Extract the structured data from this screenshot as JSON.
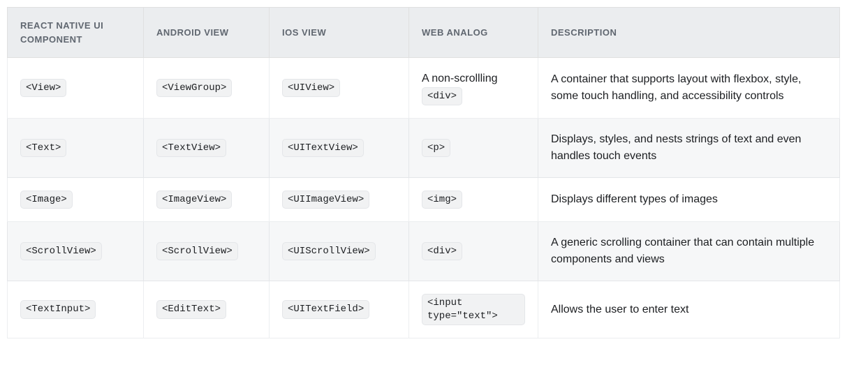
{
  "table": {
    "headers": {
      "rn": "React Native UI Component",
      "android": "Android View",
      "ios": "iOS View",
      "web": "Web Analog",
      "desc": "Description"
    },
    "rows": [
      {
        "rn_code": "<View>",
        "android_code": "<ViewGroup>",
        "ios_code": "<UIView>",
        "web_prefix": "A non-scrollling ",
        "web_code": "<div>",
        "desc": "A container that supports layout with flexbox, style, some touch handling, and accessibility controls"
      },
      {
        "rn_code": "<Text>",
        "android_code": "<TextView>",
        "ios_code": "<UITextView>",
        "web_prefix": "",
        "web_code": "<p>",
        "desc": "Displays, styles, and nests strings of text and even handles touch events"
      },
      {
        "rn_code": "<Image>",
        "android_code": "<ImageView>",
        "ios_code": "<UIImageView>",
        "web_prefix": "",
        "web_code": "<img>",
        "desc": "Displays different types of images"
      },
      {
        "rn_code": "<ScrollView>",
        "android_code": "<ScrollView>",
        "ios_code": "<UIScrollView>",
        "web_prefix": "",
        "web_code": "<div>",
        "desc": "A generic scrolling container that can contain multiple components and views"
      },
      {
        "rn_code": "<TextInput>",
        "android_code": "<EditText>",
        "ios_code": "<UITextField>",
        "web_prefix": "",
        "web_code": "<input type=\"text\">",
        "desc": "Allows the user to enter text"
      }
    ]
  }
}
